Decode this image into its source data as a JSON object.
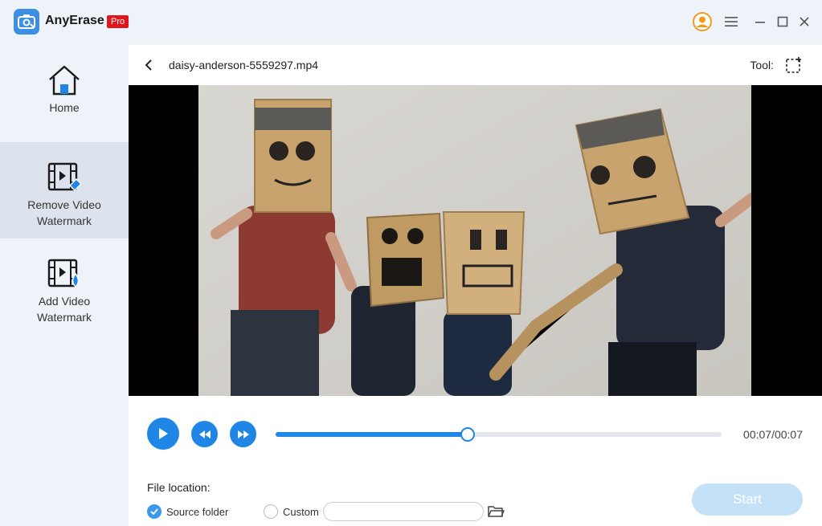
{
  "app": {
    "name": "AnyErase",
    "badge": "Pro",
    "brand_color": "#3d8fe3",
    "badge_color": "#e0161f"
  },
  "window_controls": [
    {
      "name": "user-avatar-icon"
    },
    {
      "name": "menu-icon"
    },
    {
      "name": "minimize-icon"
    },
    {
      "name": "maximize-icon"
    },
    {
      "name": "close-icon"
    }
  ],
  "sidebar": {
    "items": [
      {
        "label": "Home",
        "icon": "home-icon",
        "active": false
      },
      {
        "label": "Remove Video\nWatermark",
        "icon": "remove-watermark-icon",
        "active": true
      },
      {
        "label": "Add Video\nWatermark",
        "icon": "add-watermark-icon",
        "active": false
      }
    ]
  },
  "editor": {
    "file_name": "daisy-anderson-5559297.mp4",
    "tool_label": "Tool:",
    "tool_icon": "selection-rectangle-icon"
  },
  "player": {
    "progress": 0.43,
    "time": "00:07/00:07",
    "accent": "#1f86e6"
  },
  "output": {
    "file_location_label": "File location:",
    "options": [
      {
        "label": "Source folder",
        "checked": true
      },
      {
        "label": "Custom",
        "checked": false
      }
    ],
    "custom_path_value": "",
    "start_label": "Start"
  }
}
